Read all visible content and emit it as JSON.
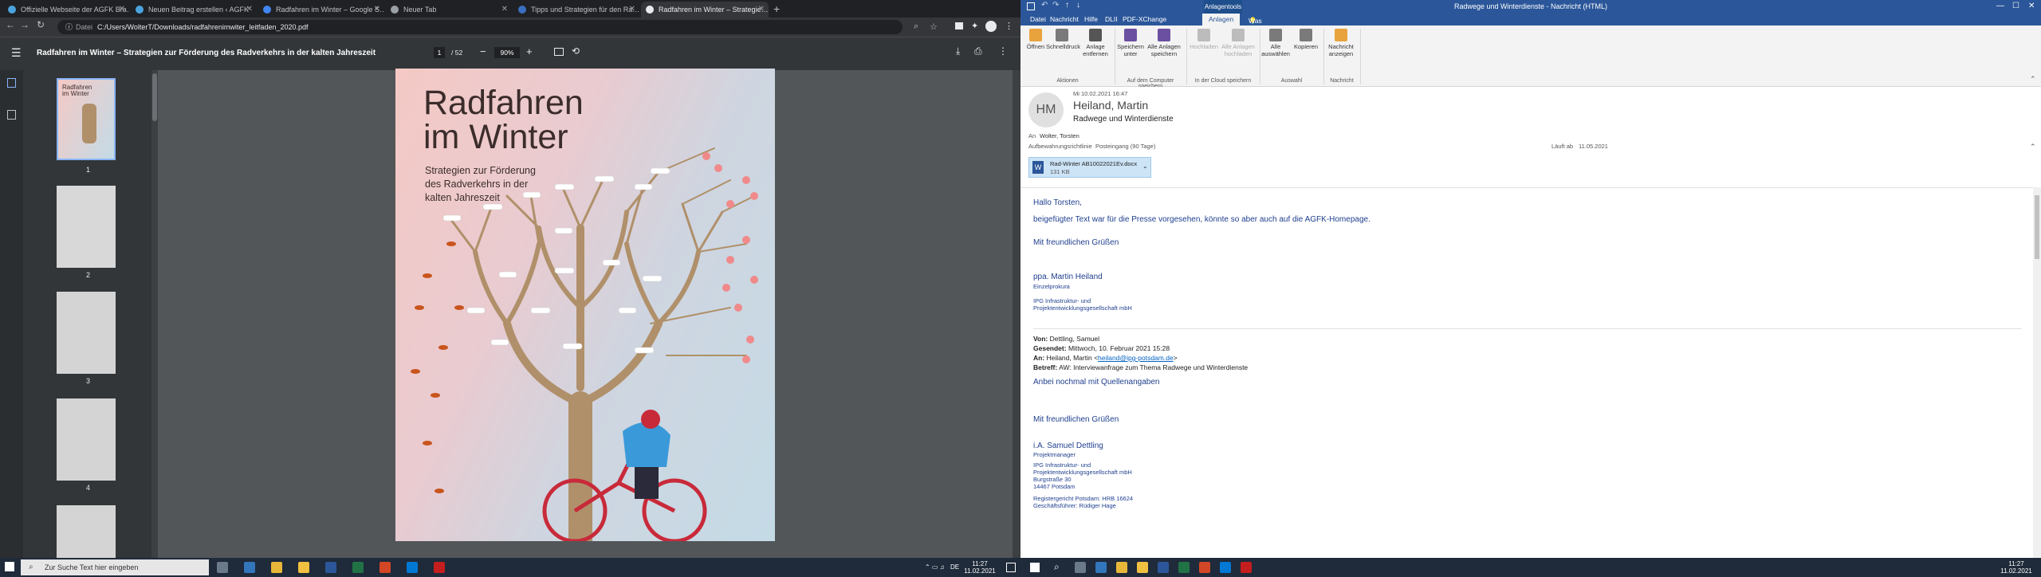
{
  "browser": {
    "tabs": [
      {
        "title": "Offizielle Webseite der AGFK Bra…",
        "color": "#4aa3df"
      },
      {
        "title": "Neuen Beitrag erstellen ‹ AGFK",
        "color": "#4aa3df"
      },
      {
        "title": "Radfahren im Winter – Google S…",
        "color": "#4285f4"
      },
      {
        "title": "Neuer Tab",
        "color": "#9aa0a6"
      },
      {
        "title": "Tipps und Strategien für den Ra…",
        "color": "#3b6fc1"
      },
      {
        "title": "Radfahren im Winter – Strategie…",
        "color": "#e8eaed"
      }
    ],
    "address_scheme": "Datei",
    "address_url": "C:/Users/WolterT/Downloads/radfahrenimwiter_leitfaden_2020.pdf",
    "new_tab": "+"
  },
  "pdf": {
    "title": "Radfahren im Winter – Strategien zur Förderung des Radverkehrs in der kalten Jahreszeit",
    "page_current": "1",
    "page_total": "/ 52",
    "zoom": "90%",
    "thumb_labels": [
      "1",
      "2",
      "3",
      "4"
    ],
    "cover_title_1": "Radfahren",
    "cover_title_2": "im Winter",
    "cover_subtitle_1": "Strategien zur Förderung",
    "cover_subtitle_2": "des Radverkehrs in der",
    "cover_subtitle_3": "kalten Jahreszeit"
  },
  "taskbar_left": {
    "search_placeholder": "Zur Suche Text hier eingeben",
    "time": "11:27",
    "date": "11.02.2021",
    "lang": "DE"
  },
  "outlook": {
    "window_title": "Radwege und Winterdienste  -  Nachricht (HTML)",
    "context_tab": "Anlagentools",
    "menu": [
      "Datei",
      "Nachricht",
      "Hilfe",
      "DLII",
      "PDF-XChange",
      "Anlagen",
      "Was möchten Sie tun?"
    ],
    "ribbon_buttons": [
      {
        "label": "Öffnen",
        "color": "#e8a33d"
      },
      {
        "label": "Schnelldruck",
        "color": "#7a7a7a"
      },
      {
        "label": "Anlage entfernen",
        "color": "#555555"
      },
      {
        "label": "Speichern unter",
        "color": "#6b4fa0"
      },
      {
        "label": "Alle Anlagen speichern",
        "color": "#6b4fa0"
      },
      {
        "label": "Hochladen",
        "color": "#bcbcbc"
      },
      {
        "label": "Alle Anlagen hochladen",
        "color": "#bcbcbc"
      },
      {
        "label": "Alle auswählen",
        "color": "#7a7a7a"
      },
      {
        "label": "Kopieren",
        "color": "#7a7a7a"
      },
      {
        "label": "Nachricht anzeigen",
        "color": "#e8a33d"
      }
    ],
    "ribbon_groups": [
      "Aktionen",
      "Auf dem Computer speichern",
      "In der Cloud speichern",
      "Auswahl",
      "Nachricht"
    ],
    "avatar_initials": "HM",
    "date_sent": "Mi 10.02.2021 16:47",
    "sender": "Heiland, Martin",
    "subject": "Radwege und Winterdienste",
    "to_label": "An",
    "to_value": "Wolter, Torsten",
    "retention_label": "Aufbewahrungsrichtlinie",
    "retention_value": "Posteingang (90 Tage)",
    "expires_label": "Läuft ab",
    "expires_value": "11.05.2021",
    "attachment_name": "Rad-Winter AB10022021Ev.docx",
    "attachment_size": "131 KB",
    "body": {
      "greeting": "Hallo Torsten,",
      "line1": "beigefügter Text war für die Presse vorgesehen, könnte so aber auch auf die AGFK-Homepage.",
      "regards1": "Mit freundlichen Grüßen",
      "sig_name": "ppa. Martin Heiland",
      "sig_role": "Einzelprokura",
      "sig_company1": "IPG Infrastruktur- und",
      "sig_company2": "Projektentwicklungsgesellschaft mbH",
      "from_label": "Von:",
      "from_value": "Dettling, Samuel",
      "sent_label": "Gesendet:",
      "sent_value": "Mittwoch, 10. Februar 2021 15:28",
      "to2_label": "An:",
      "to2_value_pre": "Heiland, Martin <",
      "to2_email": "heiland@ipg-potsdam.de",
      "to2_value_post": ">",
      "subject_label": "Betreff:",
      "subject_value": "AW: Interviewanfrage zum Thema Radwege und Winterdienste",
      "line2": "Anbei nochmal mit Quellenangaben",
      "regards2": "Mit freundlichen Grüßen",
      "sig2_name": "i.A. Samuel Dettling",
      "sig2_role": "Projektmanager",
      "sig2_c1": "IPG Infrastruktur- und",
      "sig2_c2": "Projektentwicklungsgesellschaft mbH",
      "sig2_c3": "Burgstraße 30",
      "sig2_c4": "14467 Potsdam",
      "sig2_c5": "Registergericht Potsdam: HRB 16624",
      "sig2_c6": "Geschäftsführer: Rüdiger Hage"
    }
  },
  "taskbar_right": {
    "time": "11:27",
    "date": "11.02.2021"
  }
}
